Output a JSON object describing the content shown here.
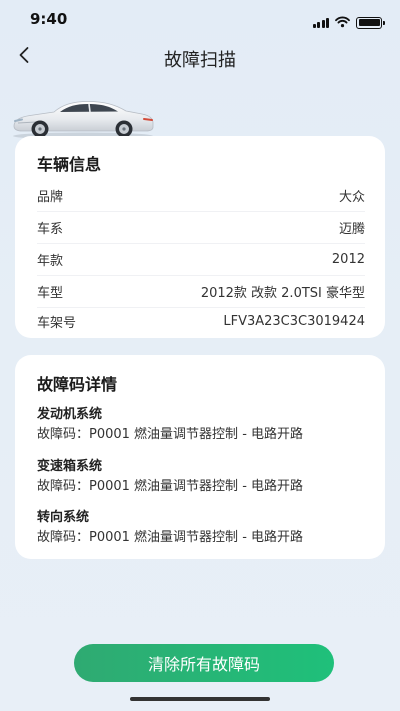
{
  "status_bar": {
    "time": "9:40",
    "icons": [
      "signal-icon",
      "wifi-icon",
      "battery-icon"
    ]
  },
  "nav": {
    "back_icon": "chevron-left-icon",
    "title": "故障扫描"
  },
  "car_image": "car-image",
  "vehicle_info": {
    "title": "车辆信息",
    "rows": [
      {
        "label": "品牌",
        "value": "大众"
      },
      {
        "label": "车系",
        "value": "迈腾"
      },
      {
        "label": "年款",
        "value": "2012"
      },
      {
        "label": "车型",
        "value": "2012款 改款 2.0TSI 豪华型"
      },
      {
        "label": "车架号",
        "value": "LFV3A23C3C3019424"
      }
    ]
  },
  "fault_details": {
    "title": "故障码详情",
    "items": [
      {
        "system": "发动机系统",
        "code": "故障码：P0001 燃油量调节器控制 - 电路开路"
      },
      {
        "system": "变速箱系统",
        "code": "故障码：P0001 燃油量调节器控制 - 电路开路"
      },
      {
        "system": "转向系统",
        "code": "故障码：P0001 燃油量调节器控制 - 电路开路"
      }
    ]
  },
  "clear_button": {
    "label": "清除所有故障码"
  },
  "colors": {
    "background": "#e4edf6",
    "card": "#ffffff",
    "accent_green": "#1fbf7a"
  }
}
